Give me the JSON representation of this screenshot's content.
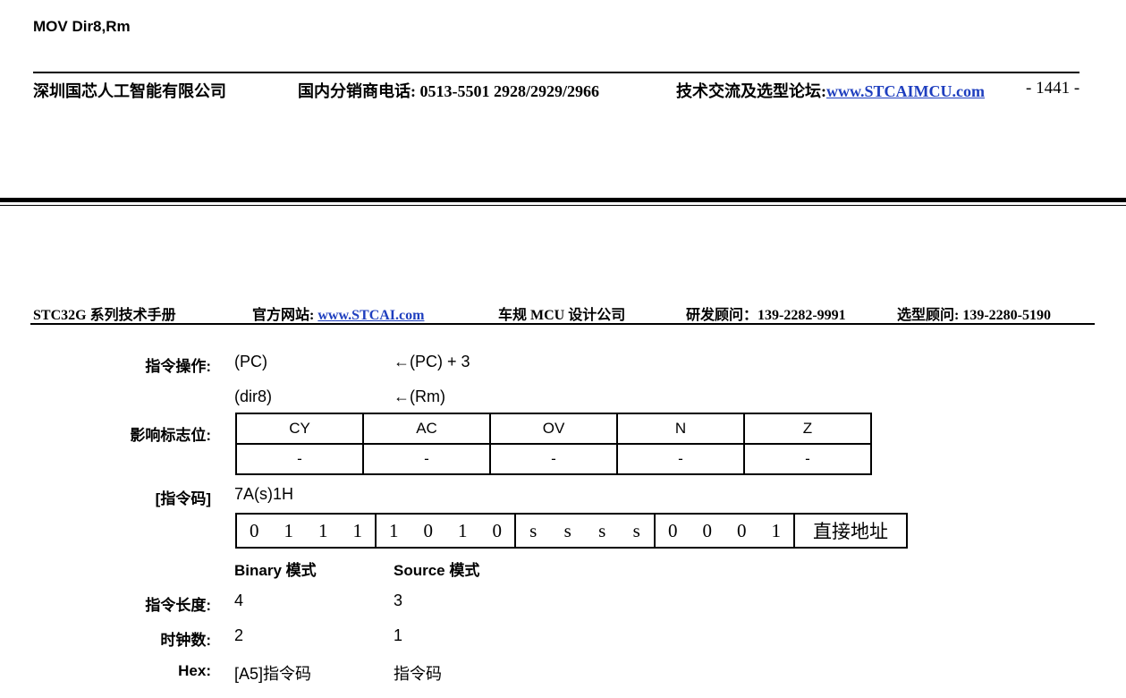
{
  "top": {
    "instruction_title": "MOV Dir8,Rm",
    "company": "深圳国芯人工智能有限公司",
    "phone_label": "国内分销商电话:",
    "phone": "0513-5501 2928/2929/2966",
    "forum_label": "技术交流及选型论坛:",
    "forum_link": "www.STCAIMCU.com",
    "page_number": "- 1441 -"
  },
  "header": {
    "manual": "STC32G 系列技术手册",
    "site_label": "官方网站:",
    "site_link": "www.STCAI.com",
    "auto": "车规 MCU 设计公司",
    "rd_consult": "研发顾问：139-2282-9991",
    "select_consult": "选型顾问: 139-2280-5190"
  },
  "operation": {
    "label": "指令操作:",
    "rows": [
      {
        "dest": "(PC)",
        "src": "←(PC) + 3"
      },
      {
        "dest": "(dir8)",
        "src": "←(Rm)"
      }
    ]
  },
  "flags": {
    "label": "影响标志位:",
    "headers": [
      "CY",
      "AC",
      "OV",
      "N",
      "Z"
    ],
    "values": [
      "-",
      "-",
      "-",
      "-",
      "-"
    ]
  },
  "opcode": {
    "label": "[指令码]",
    "code": "7A(s)1H",
    "groups": [
      [
        "0",
        "1",
        "1",
        "1"
      ],
      [
        "1",
        "0",
        "1",
        "0"
      ],
      [
        "s",
        "s",
        "s",
        "s"
      ],
      [
        "0",
        "0",
        "0",
        "1"
      ]
    ],
    "direct": "直接地址"
  },
  "modes": {
    "binary": "Binary 模式",
    "source": "Source 模式"
  },
  "length": {
    "label": "指令长度:",
    "binary": "4",
    "source": "3"
  },
  "clocks": {
    "label": "时钟数:",
    "binary": "2",
    "source": "1"
  },
  "hex": {
    "label": "Hex:",
    "binary": "[A5]指令码",
    "source": "指令码"
  }
}
